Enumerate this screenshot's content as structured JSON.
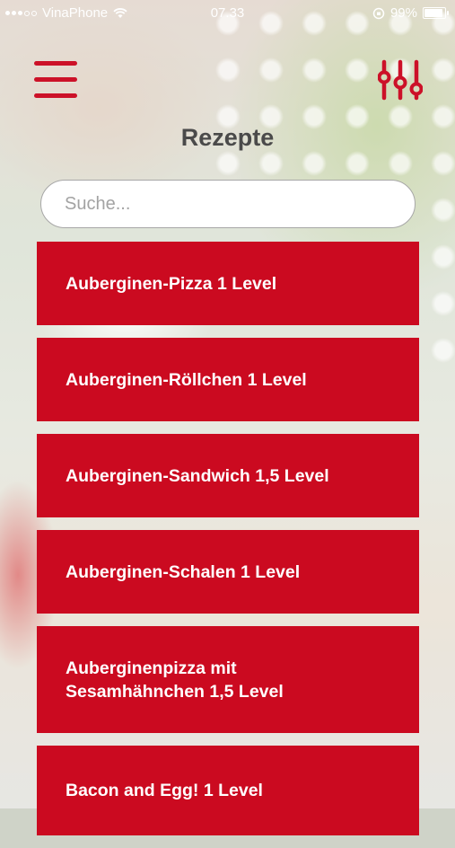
{
  "status_bar": {
    "carrier": "VinaPhone",
    "time": "07.33",
    "battery_percent": "99%",
    "battery_level": 0.99
  },
  "header": {
    "title": "Rezepte",
    "menu_icon": "hamburger-menu-icon",
    "filter_icon": "sliders-filter-icon"
  },
  "search": {
    "placeholder": "Suche...",
    "value": ""
  },
  "recipes": [
    {
      "label": "Auberginen-Pizza 1 Level"
    },
    {
      "label": "Auberginen-Röllchen 1 Level"
    },
    {
      "label": "Auberginen-Sandwich 1,5 Level"
    },
    {
      "label": "Auberginen-Schalen 1 Level"
    },
    {
      "label": "Auberginenpizza mit Sesamhähnchen 1,5 Level"
    },
    {
      "label": "Bacon and Egg! 1 Level"
    }
  ],
  "colors": {
    "accent": "#cb0a20",
    "title_text": "#4a4a4a",
    "item_text": "#ffffff"
  }
}
